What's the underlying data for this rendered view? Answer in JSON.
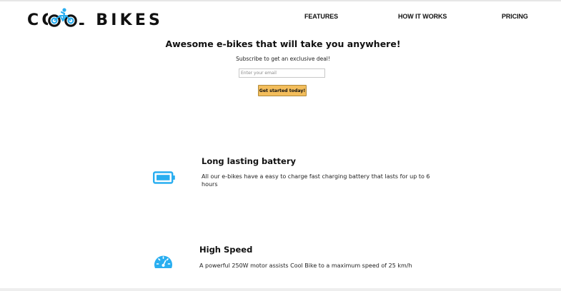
{
  "brand": {
    "logo_text": "COOL BIKES",
    "logo_color": "#111111",
    "accent_color": "#29aef0",
    "icon": "bicycle-rider-icon"
  },
  "nav": {
    "items": [
      {
        "label": "FEATURES"
      },
      {
        "label": "HOW IT WORKS"
      },
      {
        "label": "PRICING"
      }
    ]
  },
  "hero": {
    "title": "Awesome e-bikes that will take you anywhere!",
    "subtitle": "Subscribe to get an exclusive deal!",
    "email_placeholder": "Enter your email",
    "email_value": "",
    "cta_label": "Get started today!",
    "cta_color": "#f3bd5b"
  },
  "features": [
    {
      "icon": "battery-icon",
      "title": "Long lasting battery",
      "text": "All our e-bikes have a easy to charge fast charging battery that lasts for up to 6 hours"
    },
    {
      "icon": "speedometer-icon",
      "title": "High Speed",
      "text": "A powerful 250W motor assists Cool Bike to a maximum speed of 25 km/h"
    }
  ]
}
